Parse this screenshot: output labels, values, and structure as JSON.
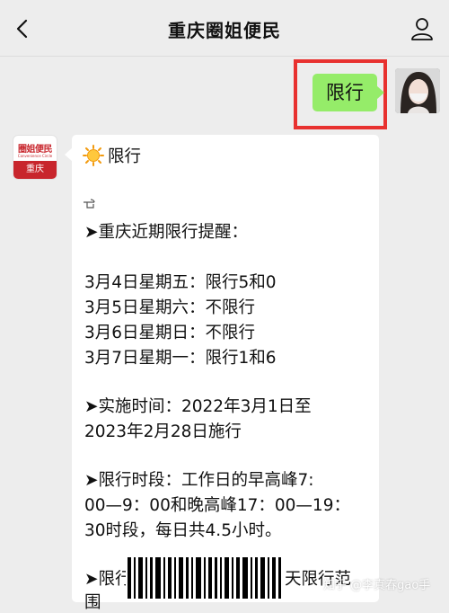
{
  "header": {
    "title": "重庆圈姐便民"
  },
  "outgoing": {
    "text": "限行"
  },
  "sender": {
    "logo_top": "圈姐便民",
    "logo_sub": "Convenience Circle",
    "logo_city": "重庆"
  },
  "message": {
    "title": "限行",
    "heading": "➤重庆近期限行提醒：",
    "days": [
      "3月4日星期五：限行5和0",
      "3月5日星期六：不限行",
      "3月6日星期日：不限行",
      "3月7日星期一：限行1和6"
    ],
    "period_lines": [
      "➤实施时间：2022年3月1日至",
      "2023年2月28日施行"
    ],
    "hours_lines": [
      "➤限行时段：工作日的早高峰7:",
      "00—9：00和晚高峰17：00—19：",
      "30时段，每日共4.5小时。"
    ],
    "range_left": "➤限行",
    "range_right": "天限行范",
    "cut_line": "围"
  },
  "watermark": "知乎 @李真春gao手",
  "colors": {
    "bg": "#ededed",
    "out_bubble": "#95ec69",
    "highlight": "#e8312f",
    "brand_red": "#c8252c"
  }
}
